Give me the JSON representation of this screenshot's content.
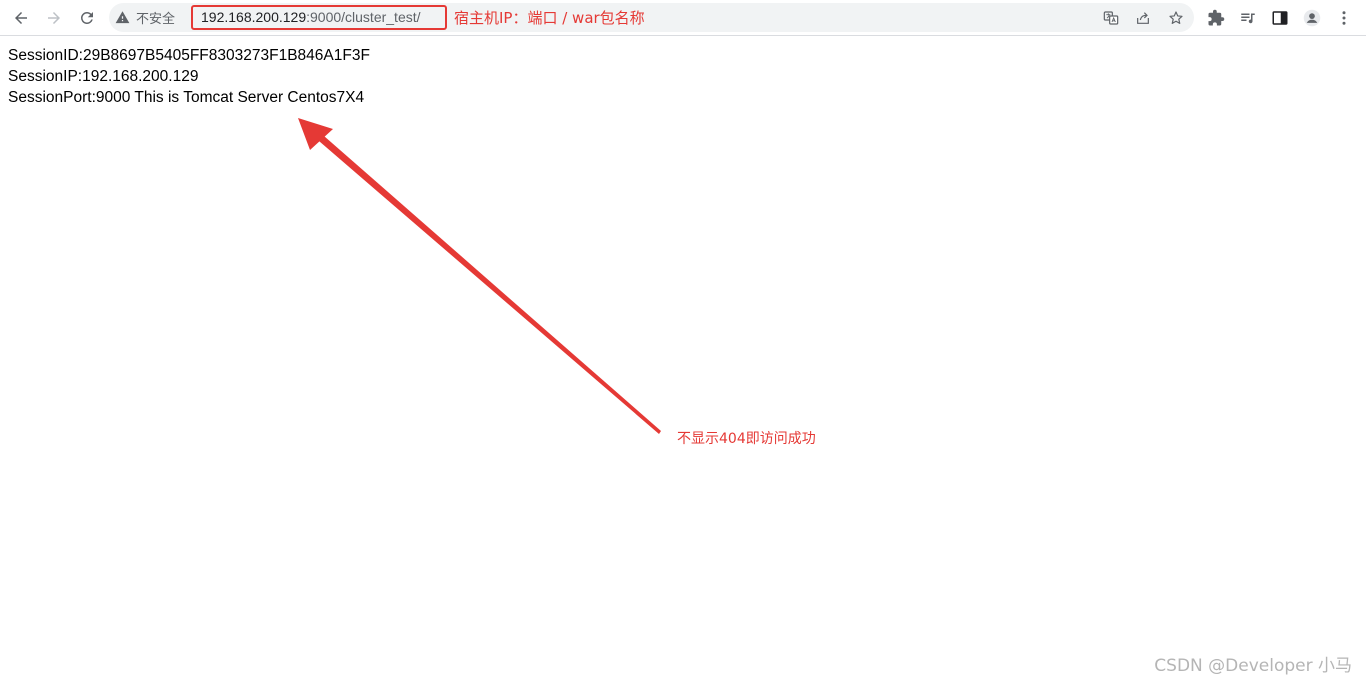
{
  "browser": {
    "security_label": "不安全",
    "url_host": "192.168.200.129",
    "url_path": ":9000/cluster_test/",
    "icons": {
      "back": "arrow-left-icon",
      "forward": "arrow-right-icon",
      "reload": "reload-icon",
      "warning": "warning-triangle-icon",
      "translate": "translate-icon",
      "share": "share-icon",
      "bookmark": "star-icon",
      "extensions": "puzzle-icon",
      "media": "media-queue-icon",
      "side_panel": "side-panel-icon",
      "profile": "profile-icon",
      "menu": "kebab-menu-icon"
    }
  },
  "annotations": {
    "url_note": "宿主机IP：端口 / war包名称",
    "success_note": "不显示404即访问成功",
    "color": "#e53935"
  },
  "page": {
    "session_id": "SessionID:29B8697B5405FF8303273F1B846A1F3F",
    "session_ip": "SessionIP:192.168.200.129",
    "session_port": "SessionPort:9000 This is Tomcat Server Centos7X4"
  },
  "watermark": "CSDN @Developer 小马"
}
